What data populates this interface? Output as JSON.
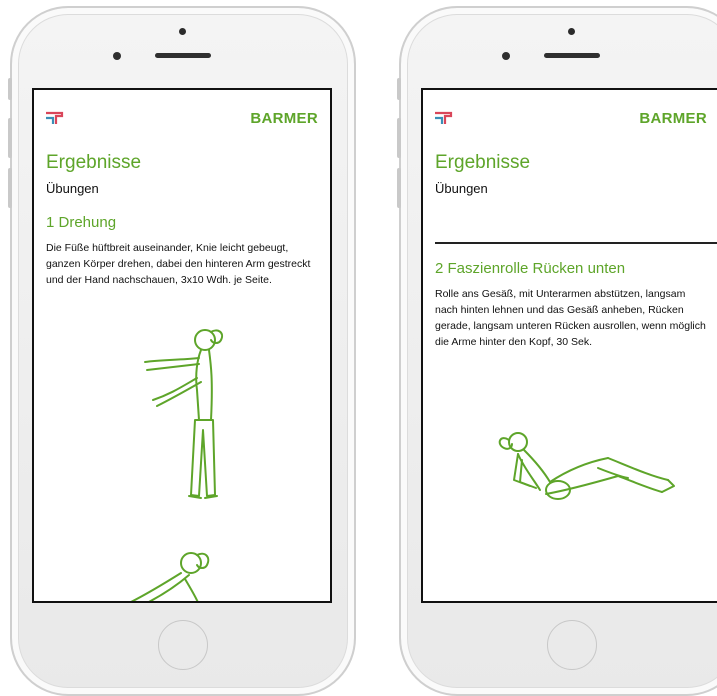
{
  "brand": "BARMER",
  "colors": {
    "accent_green": "#5ea52a",
    "logo_red": "#d9465a",
    "logo_blue": "#3a8fb7",
    "text": "#111111"
  },
  "left_screen": {
    "title": "Ergebnisse",
    "subtitle": "Übungen",
    "exercise": {
      "title": "1 Drehung",
      "description": "Die Füße hüftbreit auseinander, Knie leicht gebeugt, ganzen Körper drehen, dabei den hinteren Arm gestreckt und der Hand nachschauen, 3x10 Wdh. je Seite."
    },
    "illustrations": [
      "standing-rotation-figure",
      "lying-figure-partial"
    ]
  },
  "right_screen": {
    "title": "Ergebnisse",
    "subtitle": "Übungen",
    "exercise": {
      "title": "2 Faszienrolle Rücken unten",
      "description": "Rolle ans Gesäß, mit Unterarmen abstützen, langsam nach hinten lehnen und das Gesäß anheben, Rücken gerade, langsam unteren Rücken ausrollen, wenn möglich die Arme hinter den Kopf, 30 Sek."
    },
    "illustrations": [
      "foam-roller-figure"
    ]
  }
}
